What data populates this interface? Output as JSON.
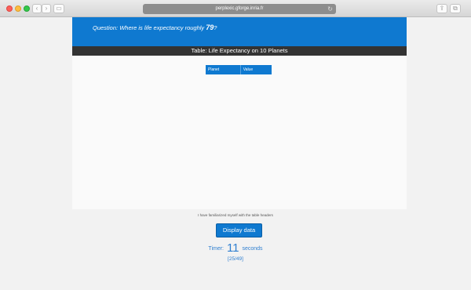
{
  "browser": {
    "url": "perplexic.gforge.inria.fr",
    "back_glyph": "‹",
    "forward_glyph": "›",
    "sidebar_glyph": "▭",
    "reload_glyph": "↻",
    "share_glyph": "⇪",
    "tabs_glyph": "⧉"
  },
  "question": {
    "label": "Question:",
    "text": "Where is life expectancy roughly",
    "value": "79",
    "suffix": "?"
  },
  "table": {
    "title": "Table: Life Expectancy on 10 Planets",
    "headers": [
      "Planet",
      "Value"
    ]
  },
  "controls": {
    "confirm_text": "I have familiarized myself with the table headers",
    "display_button": "Display data"
  },
  "timer": {
    "label": "Timer:",
    "value": "11",
    "unit": "seconds"
  },
  "progress": "[25/49]",
  "colors": {
    "accent": "#0f79d0",
    "title_bar": "#333333"
  }
}
